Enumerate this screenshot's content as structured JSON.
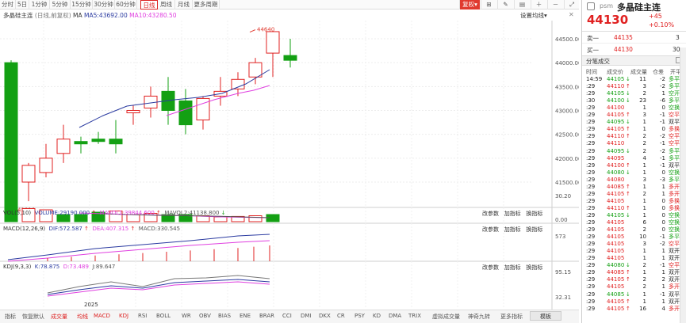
{
  "periods": [
    "分时",
    "5日",
    "1分钟",
    "5分钟",
    "15分钟",
    "30分钟",
    "60分钟",
    "日线",
    "周线",
    "月线",
    "更多周期"
  ],
  "active_period": "日线",
  "toolbar_right": {
    "adjust": "复权",
    "adjust_arrow": "▾"
  },
  "info": {
    "name": "多晶硅主连",
    "mode": "(日线,前复权)",
    "ma_label": "MA",
    "ma5": "MA5:43692.00",
    "ma10": "MA10:43280.50",
    "settings": "设置均线"
  },
  "colors": {
    "up": "#e02020",
    "down": "#13a013",
    "ma5": "#2a3aa0",
    "ma10": "#e040e0",
    "accent": "#e03a2f"
  },
  "price_axis": [
    "44500.00",
    "44000.00",
    "43500.00",
    "43000.00",
    "42500.00",
    "42000.00",
    "41500.00"
  ],
  "annotations": {
    "high": "44640",
    "low": "41010"
  },
  "vol": {
    "title": "VOL(5,10)",
    "volume": "VOLUME:29190.000",
    "mavol1": "MAVOL1:39844.600",
    "mavol2": "MAVOL2:41138.800",
    "axis": [
      "30.20",
      "0.00"
    ],
    "tools": [
      "改参数",
      "加指标",
      "换指标"
    ]
  },
  "macd": {
    "title": "MACD(12,26,9)",
    "dif": "DIF:572.587",
    "dea": "DEA:407.315",
    "macd": "MACD:330.545",
    "axis": [
      "573"
    ]
  },
  "kdj": {
    "title": "KDJ(9,3,3)",
    "k": "K:78.875",
    "d": "D:73.489",
    "j": "J:89.647",
    "axis": [
      "95.15",
      "32.31"
    ]
  },
  "date_label": "2025",
  "bottom_tabs": [
    "指标",
    "恢复默认",
    "成交量",
    "均线",
    "MACD",
    "KDJ",
    "RSI",
    "BOLL",
    "WR",
    "OBV",
    "BIAS",
    "ENE",
    "BRAR",
    "CCI",
    "DMI",
    "DKX",
    "CR",
    "PSY",
    "KD",
    "DMA",
    "TRIX",
    "虚拟成交量",
    "神奇九转",
    "更多指标"
  ],
  "bottom_selected": [
    "成交量",
    "均线",
    "MACD",
    "KDJ"
  ],
  "side_tab": "模板",
  "right": {
    "tag": "psm",
    "name": "多晶硅主连",
    "price": "44130",
    "change": "+45",
    "pct": "+0.10%",
    "sell_label": "卖一",
    "sell_price": "44135",
    "sell_vol": "3",
    "buy_label": "买一",
    "buy_price": "44130",
    "buy_vol": "30",
    "tab": "分笔成交",
    "headers": [
      "时间",
      "成交价",
      "成交量",
      "仓差",
      "开平"
    ],
    "ticks": [
      {
        "t": "14:59",
        "p": "44105",
        "a": "↓",
        "v": "11",
        "d": "-2",
        "k": "多平",
        "c": "grn"
      },
      {
        "t": ":29",
        "p": "44110",
        "a": "↑",
        "v": "3",
        "d": "-2",
        "k": "多平",
        "c": "grn"
      },
      {
        "t": ":29",
        "p": "44105",
        "a": "↓",
        "v": "2",
        "d": "1",
        "k": "空开",
        "c": "grn"
      },
      {
        "t": ":30",
        "p": "44100",
        "a": "↓",
        "v": "23",
        "d": "-6",
        "k": "多平",
        "c": "grn"
      },
      {
        "t": ":29",
        "p": "44100",
        "a": "",
        "v": "1",
        "d": "0",
        "k": "空换",
        "c": "grn"
      },
      {
        "t": ":29",
        "p": "44105",
        "a": "↑",
        "v": "3",
        "d": "-1",
        "k": "空平",
        "c": "red"
      },
      {
        "t": ":29",
        "p": "44095",
        "a": "↓",
        "v": "1",
        "d": "-1",
        "k": "双平",
        "c": "blk"
      },
      {
        "t": ":29",
        "p": "44105",
        "a": "↑",
        "v": "1",
        "d": "0",
        "k": "多换",
        "c": "red"
      },
      {
        "t": ":29",
        "p": "44110",
        "a": "↑",
        "v": "2",
        "d": "-2",
        "k": "空平",
        "c": "red"
      },
      {
        "t": ":29",
        "p": "44110",
        "a": "",
        "v": "2",
        "d": "-1",
        "k": "空平",
        "c": "red"
      },
      {
        "t": ":29",
        "p": "44095",
        "a": "↓",
        "v": "2",
        "d": "-2",
        "k": "多平",
        "c": "grn"
      },
      {
        "t": ":29",
        "p": "44095",
        "a": "",
        "v": "4",
        "d": "-1",
        "k": "多平",
        "c": "grn"
      },
      {
        "t": ":29",
        "p": "44100",
        "a": "↑",
        "v": "1",
        "d": "-1",
        "k": "双平",
        "c": "blk"
      },
      {
        "t": ":29",
        "p": "44080",
        "a": "↓",
        "v": "1",
        "d": "0",
        "k": "空换",
        "c": "grn"
      },
      {
        "t": ":29",
        "p": "44080",
        "a": "",
        "v": "3",
        "d": "-3",
        "k": "多平",
        "c": "grn"
      },
      {
        "t": ":29",
        "p": "44085",
        "a": "↑",
        "v": "1",
        "d": "1",
        "k": "多开",
        "c": "red"
      },
      {
        "t": ":29",
        "p": "44105",
        "a": "↑",
        "v": "2",
        "d": "1",
        "k": "多开",
        "c": "red"
      },
      {
        "t": ":29",
        "p": "44105",
        "a": "",
        "v": "1",
        "d": "0",
        "k": "多换",
        "c": "red"
      },
      {
        "t": ":29",
        "p": "44110",
        "a": "↑",
        "v": "1",
        "d": "0",
        "k": "多换",
        "c": "red"
      },
      {
        "t": ":29",
        "p": "44105",
        "a": "↓",
        "v": "1",
        "d": "0",
        "k": "空换",
        "c": "grn"
      },
      {
        "t": ":29",
        "p": "44105",
        "a": "",
        "v": "6",
        "d": "0",
        "k": "空换",
        "c": "grn"
      },
      {
        "t": ":29",
        "p": "44105",
        "a": "",
        "v": "2",
        "d": "0",
        "k": "空换",
        "c": "grn"
      },
      {
        "t": ":29",
        "p": "44105",
        "a": "",
        "v": "10",
        "d": "-1",
        "k": "多平",
        "c": "grn"
      },
      {
        "t": ":29",
        "p": "44105",
        "a": "",
        "v": "3",
        "d": "-2",
        "k": "空平",
        "c": "red"
      },
      {
        "t": ":29",
        "p": "44105",
        "a": "",
        "v": "1",
        "d": "1",
        "k": "双开",
        "c": "blk"
      },
      {
        "t": ":29",
        "p": "44105",
        "a": "",
        "v": "1",
        "d": "1",
        "k": "双开",
        "c": "blk"
      },
      {
        "t": ":29",
        "p": "44080",
        "a": "↓",
        "v": "2",
        "d": "-1",
        "k": "空平",
        "c": "red"
      },
      {
        "t": ":29",
        "p": "44085",
        "a": "↑",
        "v": "1",
        "d": "1",
        "k": "双开",
        "c": "blk"
      },
      {
        "t": ":29",
        "p": "44105",
        "a": "↑",
        "v": "2",
        "d": "2",
        "k": "双开",
        "c": "blk"
      },
      {
        "t": ":29",
        "p": "44105",
        "a": "",
        "v": "2",
        "d": "1",
        "k": "多开",
        "c": "red"
      },
      {
        "t": ":29",
        "p": "44085",
        "a": "↓",
        "v": "1",
        "d": "-1",
        "k": "双平",
        "c": "blk"
      },
      {
        "t": ":29",
        "p": "44105",
        "a": "↑",
        "v": "1",
        "d": "1",
        "k": "双开",
        "c": "blk"
      },
      {
        "t": ":29",
        "p": "44105",
        "a": "↑",
        "v": "16",
        "d": "4",
        "k": "多开",
        "c": "red"
      }
    ]
  }
}
